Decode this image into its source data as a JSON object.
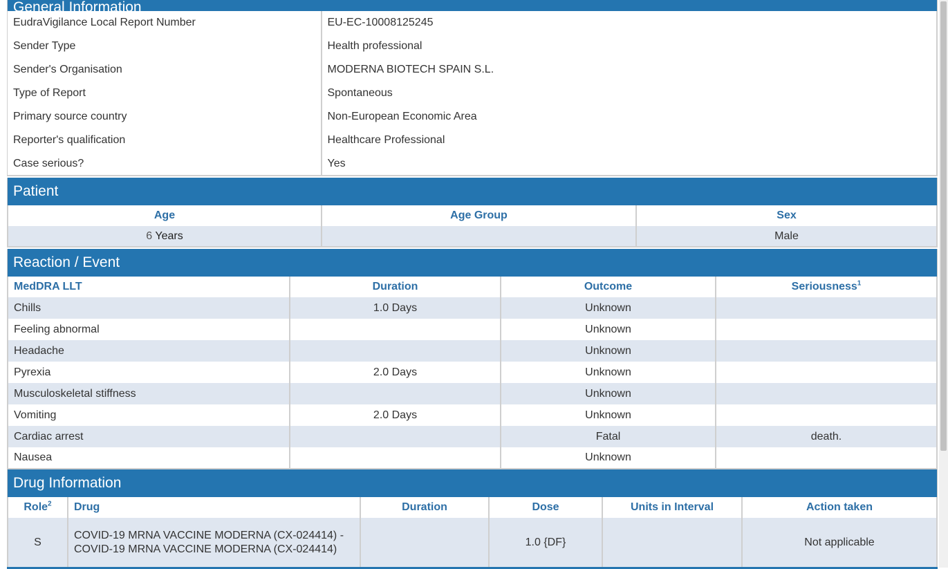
{
  "general": {
    "title": "General Information",
    "rows": [
      {
        "label": "EudraVigilance Local Report Number",
        "value": "EU-EC-10008125245"
      },
      {
        "label": "Sender Type",
        "value": "Health professional"
      },
      {
        "label": "Sender's Organisation",
        "value": "MODERNA BIOTECH SPAIN S.L."
      },
      {
        "label": "Type of Report",
        "value": "Spontaneous"
      },
      {
        "label": "Primary source country",
        "value": "Non-European Economic Area"
      },
      {
        "label": "Reporter's qualification",
        "value": "Healthcare Professional"
      },
      {
        "label": "Case serious?",
        "value": "Yes"
      }
    ]
  },
  "patient": {
    "title": "Patient",
    "headers": {
      "age": "Age",
      "age_group": "Age Group",
      "sex": "Sex"
    },
    "age_value": "6",
    "age_unit": " Years",
    "age_group": "",
    "sex": "Male"
  },
  "reaction": {
    "title": "Reaction / Event",
    "headers": {
      "llt": "MedDRA LLT",
      "duration": "Duration",
      "outcome": "Outcome",
      "seriousness": "Seriousness",
      "seriousness_sup": "1"
    },
    "rows": [
      {
        "llt": "Chills",
        "duration": "1.0 Days",
        "outcome": "Unknown",
        "seriousness": ""
      },
      {
        "llt": "Feeling abnormal",
        "duration": "",
        "outcome": "Unknown",
        "seriousness": ""
      },
      {
        "llt": "Headache",
        "duration": "",
        "outcome": "Unknown",
        "seriousness": ""
      },
      {
        "llt": "Pyrexia",
        "duration": "2.0 Days",
        "outcome": "Unknown",
        "seriousness": ""
      },
      {
        "llt": "Musculoskeletal stiffness",
        "duration": "",
        "outcome": "Unknown",
        "seriousness": ""
      },
      {
        "llt": "Vomiting",
        "duration": "2.0 Days",
        "outcome": "Unknown",
        "seriousness": ""
      },
      {
        "llt": "Cardiac arrest",
        "duration": "",
        "outcome": "Fatal",
        "seriousness": "death."
      },
      {
        "llt": "Nausea",
        "duration": "",
        "outcome": "Unknown",
        "seriousness": ""
      }
    ]
  },
  "drug": {
    "title": "Drug Information",
    "headers": {
      "role": "Role",
      "role_sup": "2",
      "drug": "Drug",
      "duration": "Duration",
      "dose": "Dose",
      "units": "Units in Interval",
      "action": "Action taken"
    },
    "rows": [
      {
        "role": "S",
        "drug": "COVID-19 MRNA VACCINE MODERNA (CX-024414) - COVID-19 MRNA VACCINE MODERNA (CX-024414)",
        "duration": "",
        "dose": "1.0 {DF}",
        "units": "",
        "action": "Not applicable"
      }
    ]
  },
  "colors": {
    "header_blue": "#2475b0",
    "header_text": "#2d6fa6",
    "row_shade": "#dfe6f0"
  }
}
